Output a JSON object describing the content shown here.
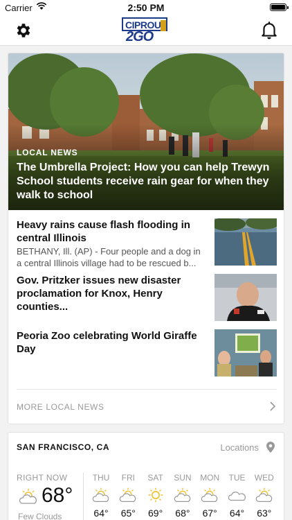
{
  "status": {
    "carrier": "Carrier",
    "time": "2:50 PM"
  },
  "nav": {
    "logo_top": "CIPROUD",
    "logo_bottom": "2GO"
  },
  "hero": {
    "kicker": "LOCAL NEWS",
    "headline": "The Umbrella Project: How you can help Trewyn School students receive rain gear for when they walk to school"
  },
  "stories": [
    {
      "title": "Heavy rains cause flash flooding in central Illinois",
      "summary": "BETHANY, Ill. (AP) - Four people and a dog in a central Illinois village had to be rescued b..."
    },
    {
      "title": "Gov. Pritzker issues new disaster proclamation for Knox, Henry counties...",
      "summary": ""
    },
    {
      "title": "Peoria Zoo celebrating World Giraffe Day",
      "summary": ""
    }
  ],
  "more": {
    "label": "MORE LOCAL NEWS"
  },
  "weather": {
    "city": "SAN FRANCISCO, CA",
    "locations_label": "Locations",
    "now": {
      "label": "RIGHT NOW",
      "temp": "68°",
      "condition": "Few Clouds",
      "icon": "partly-cloudy-icon"
    },
    "days": [
      {
        "label": "THU",
        "temp": "64°",
        "icon": "partly-cloudy-icon"
      },
      {
        "label": "FRI",
        "temp": "65°",
        "icon": "partly-cloudy-icon"
      },
      {
        "label": "SAT",
        "temp": "69°",
        "icon": "sun-icon"
      },
      {
        "label": "SUN",
        "temp": "68°",
        "icon": "partly-cloudy-icon"
      },
      {
        "label": "MON",
        "temp": "67°",
        "icon": "partly-cloudy-icon"
      },
      {
        "label": "TUE",
        "temp": "64°",
        "icon": "cloud-icon"
      },
      {
        "label": "WED",
        "temp": "63°",
        "icon": "partly-cloudy-icon"
      }
    ]
  },
  "colors": {
    "brand": "#1e3a8a",
    "brand_accent": "#d4a017",
    "sun": "#f2c12e"
  }
}
